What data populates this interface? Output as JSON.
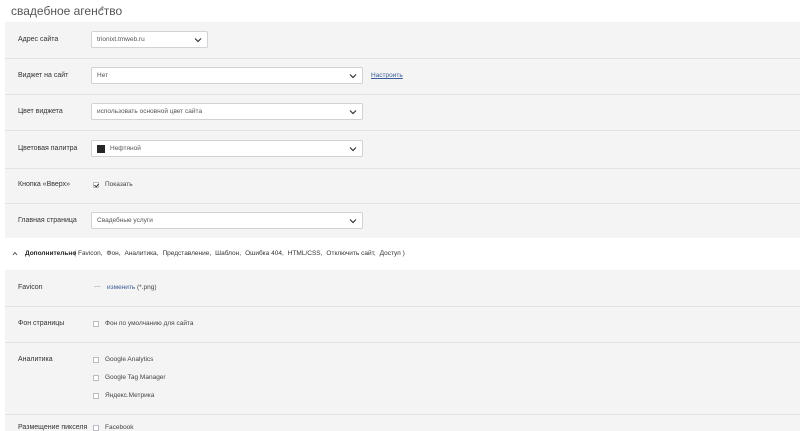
{
  "header": {
    "title": "свадебное агенство",
    "edit_icon": "pencil-icon"
  },
  "settings": {
    "site_address": {
      "label": "Адрес сайта",
      "value": "trionixt.tmweb.ru"
    },
    "widget": {
      "label": "Виджет на сайт",
      "value": "Нет",
      "configure_link": "Настроить"
    },
    "widget_color": {
      "label": "Цвет виджета",
      "value": "использовать основной цвет сайта"
    },
    "palette": {
      "label": "Цветовая палитра",
      "value": "Нефтяной",
      "swatch_color": "#262626"
    },
    "back_to_top": {
      "label": "Кнопка «Вверх»",
      "checkbox_label": "Показать",
      "checked": true
    },
    "home_page": {
      "label": "Главная страница",
      "value": "Свадебные услуги"
    }
  },
  "advanced": {
    "title": "Дополнительно",
    "items": [
      "( Favicon,",
      "Фон,",
      "Аналитика,",
      "Представление,",
      "Шаблон,",
      "Ошибка 404,",
      "HTML/CSS,",
      "Отключить сайт,",
      "Доступ )"
    ],
    "favicon": {
      "label": "Favicon",
      "placeholder": "—",
      "change_link": "изменить",
      "ext": "(*.png)"
    },
    "background": {
      "label": "Фон страницы",
      "checkbox_label": "Фон по умолчанию для сайта",
      "checked": false
    },
    "analytics": {
      "label": "Аналитика",
      "options": [
        "Google Analytics",
        "Google Tag Manager",
        "Яндекс.Метрика"
      ]
    },
    "pixel": {
      "label": "Размещение пикселя",
      "option": "Facebook"
    }
  },
  "colors": {
    "link": "#3b5c96",
    "panel_bg": "#f4f4f5",
    "border": "#cfd2d6"
  }
}
